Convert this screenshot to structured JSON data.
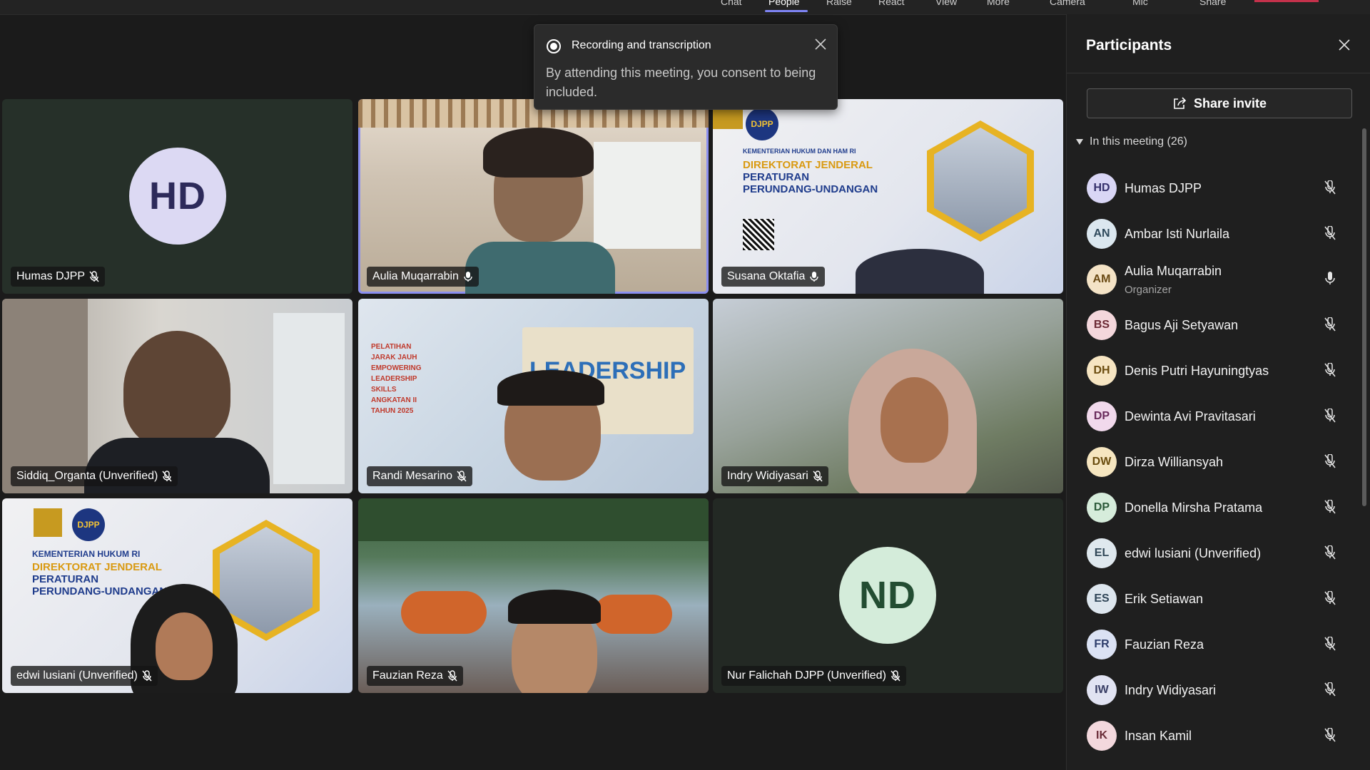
{
  "toolbar": {
    "items": [
      "Chat",
      "People",
      "Raise",
      "React",
      "View",
      "More",
      "Camera",
      "Mic",
      "Share"
    ],
    "active": "People"
  },
  "toast": {
    "title": "Recording and transcription",
    "body": "By attending this meeting, you consent to being included."
  },
  "tiles": [
    {
      "name": "Humas DJPP",
      "initials": "HD",
      "mic": "muted"
    },
    {
      "name": "Aulia Muqarrabin",
      "mic": "on"
    },
    {
      "name": "Susana Oktafia",
      "mic": "on"
    },
    {
      "name": "Siddiq_Organta (Unverified)",
      "mic": "muted"
    },
    {
      "name": "Randi Mesarino",
      "mic": "muted"
    },
    {
      "name": "Indry Widiyasari",
      "mic": "muted"
    },
    {
      "name": "edwi lusiani (Unverified)",
      "mic": "muted"
    },
    {
      "name": "Fauzian Reza",
      "mic": "muted"
    },
    {
      "name": "Nur Falichah DJPP (Unverified)",
      "initials": "ND",
      "mic": "muted"
    }
  ],
  "slides": {
    "djpp_logo": "DJPP",
    "line1": "KEMENTERIAN HUKUM DAN HAM RI",
    "line2": "DIREKTORAT JENDERAL",
    "line3": "PERATURAN",
    "line4": "PERUNDANG-UNDANGAN",
    "line1_b": "KEMENTERIAN HUKUM RI",
    "leadership": "LEADERSHIP",
    "leadership_side": [
      "PELATIHAN",
      "JARAK JAUH",
      "EMPOWERING",
      "LEADERSHIP",
      "SKILLS",
      "ANGKATAN II",
      "TAHUN 2025"
    ]
  },
  "panel": {
    "title": "Participants",
    "share_invite": "Share invite",
    "section": "In this meeting (26)",
    "participants": [
      {
        "initials": "HD",
        "name": "Humas DJPP",
        "mic": "muted",
        "color": "#d9d6f5",
        "fg": "#35306b"
      },
      {
        "initials": "AN",
        "name": "Ambar Isti Nurlaila",
        "mic": "muted",
        "color": "#dbe7ef",
        "fg": "#2f4a5c"
      },
      {
        "initials": "AM",
        "name": "Aulia Muqarrabin",
        "role": "Organizer",
        "mic": "on",
        "color": "#f4e3c6",
        "fg": "#6a4a14"
      },
      {
        "initials": "BS",
        "name": "Bagus Aji Setyawan",
        "mic": "muted",
        "color": "#f4d7dc",
        "fg": "#6b2a35"
      },
      {
        "initials": "DH",
        "name": "Denis Putri Hayuningtyas",
        "mic": "muted",
        "color": "#f6e5c2",
        "fg": "#6b4d10"
      },
      {
        "initials": "DP",
        "name": "Dewinta Avi Pravitasari",
        "mic": "muted",
        "color": "#f1d9ec",
        "fg": "#6a2b5c"
      },
      {
        "initials": "DW",
        "name": "Dirza Williansyah",
        "mic": "muted",
        "color": "#f6e6c0",
        "fg": "#6b4e10"
      },
      {
        "initials": "DP",
        "name": "Donella Mirsha Pratama",
        "mic": "muted",
        "color": "#d6ecdb",
        "fg": "#2c5a3a"
      },
      {
        "initials": "EL",
        "name": "edwi lusiani (Unverified)",
        "mic": "muted",
        "color": "#dfe8ee",
        "fg": "#33495a"
      },
      {
        "initials": "ES",
        "name": "Erik Setiawan",
        "mic": "muted",
        "color": "#dde6ee",
        "fg": "#2f4557"
      },
      {
        "initials": "FR",
        "name": "Fauzian Reza",
        "mic": "muted",
        "color": "#dbe2f4",
        "fg": "#2d3d6b"
      },
      {
        "initials": "IW",
        "name": "Indry Widiyasari",
        "mic": "muted",
        "color": "#e1e3f2",
        "fg": "#3a3f66"
      },
      {
        "initials": "IK",
        "name": "Insan Kamil",
        "mic": "muted",
        "color": "#f3d8dd",
        "fg": "#6a2d38"
      }
    ]
  }
}
